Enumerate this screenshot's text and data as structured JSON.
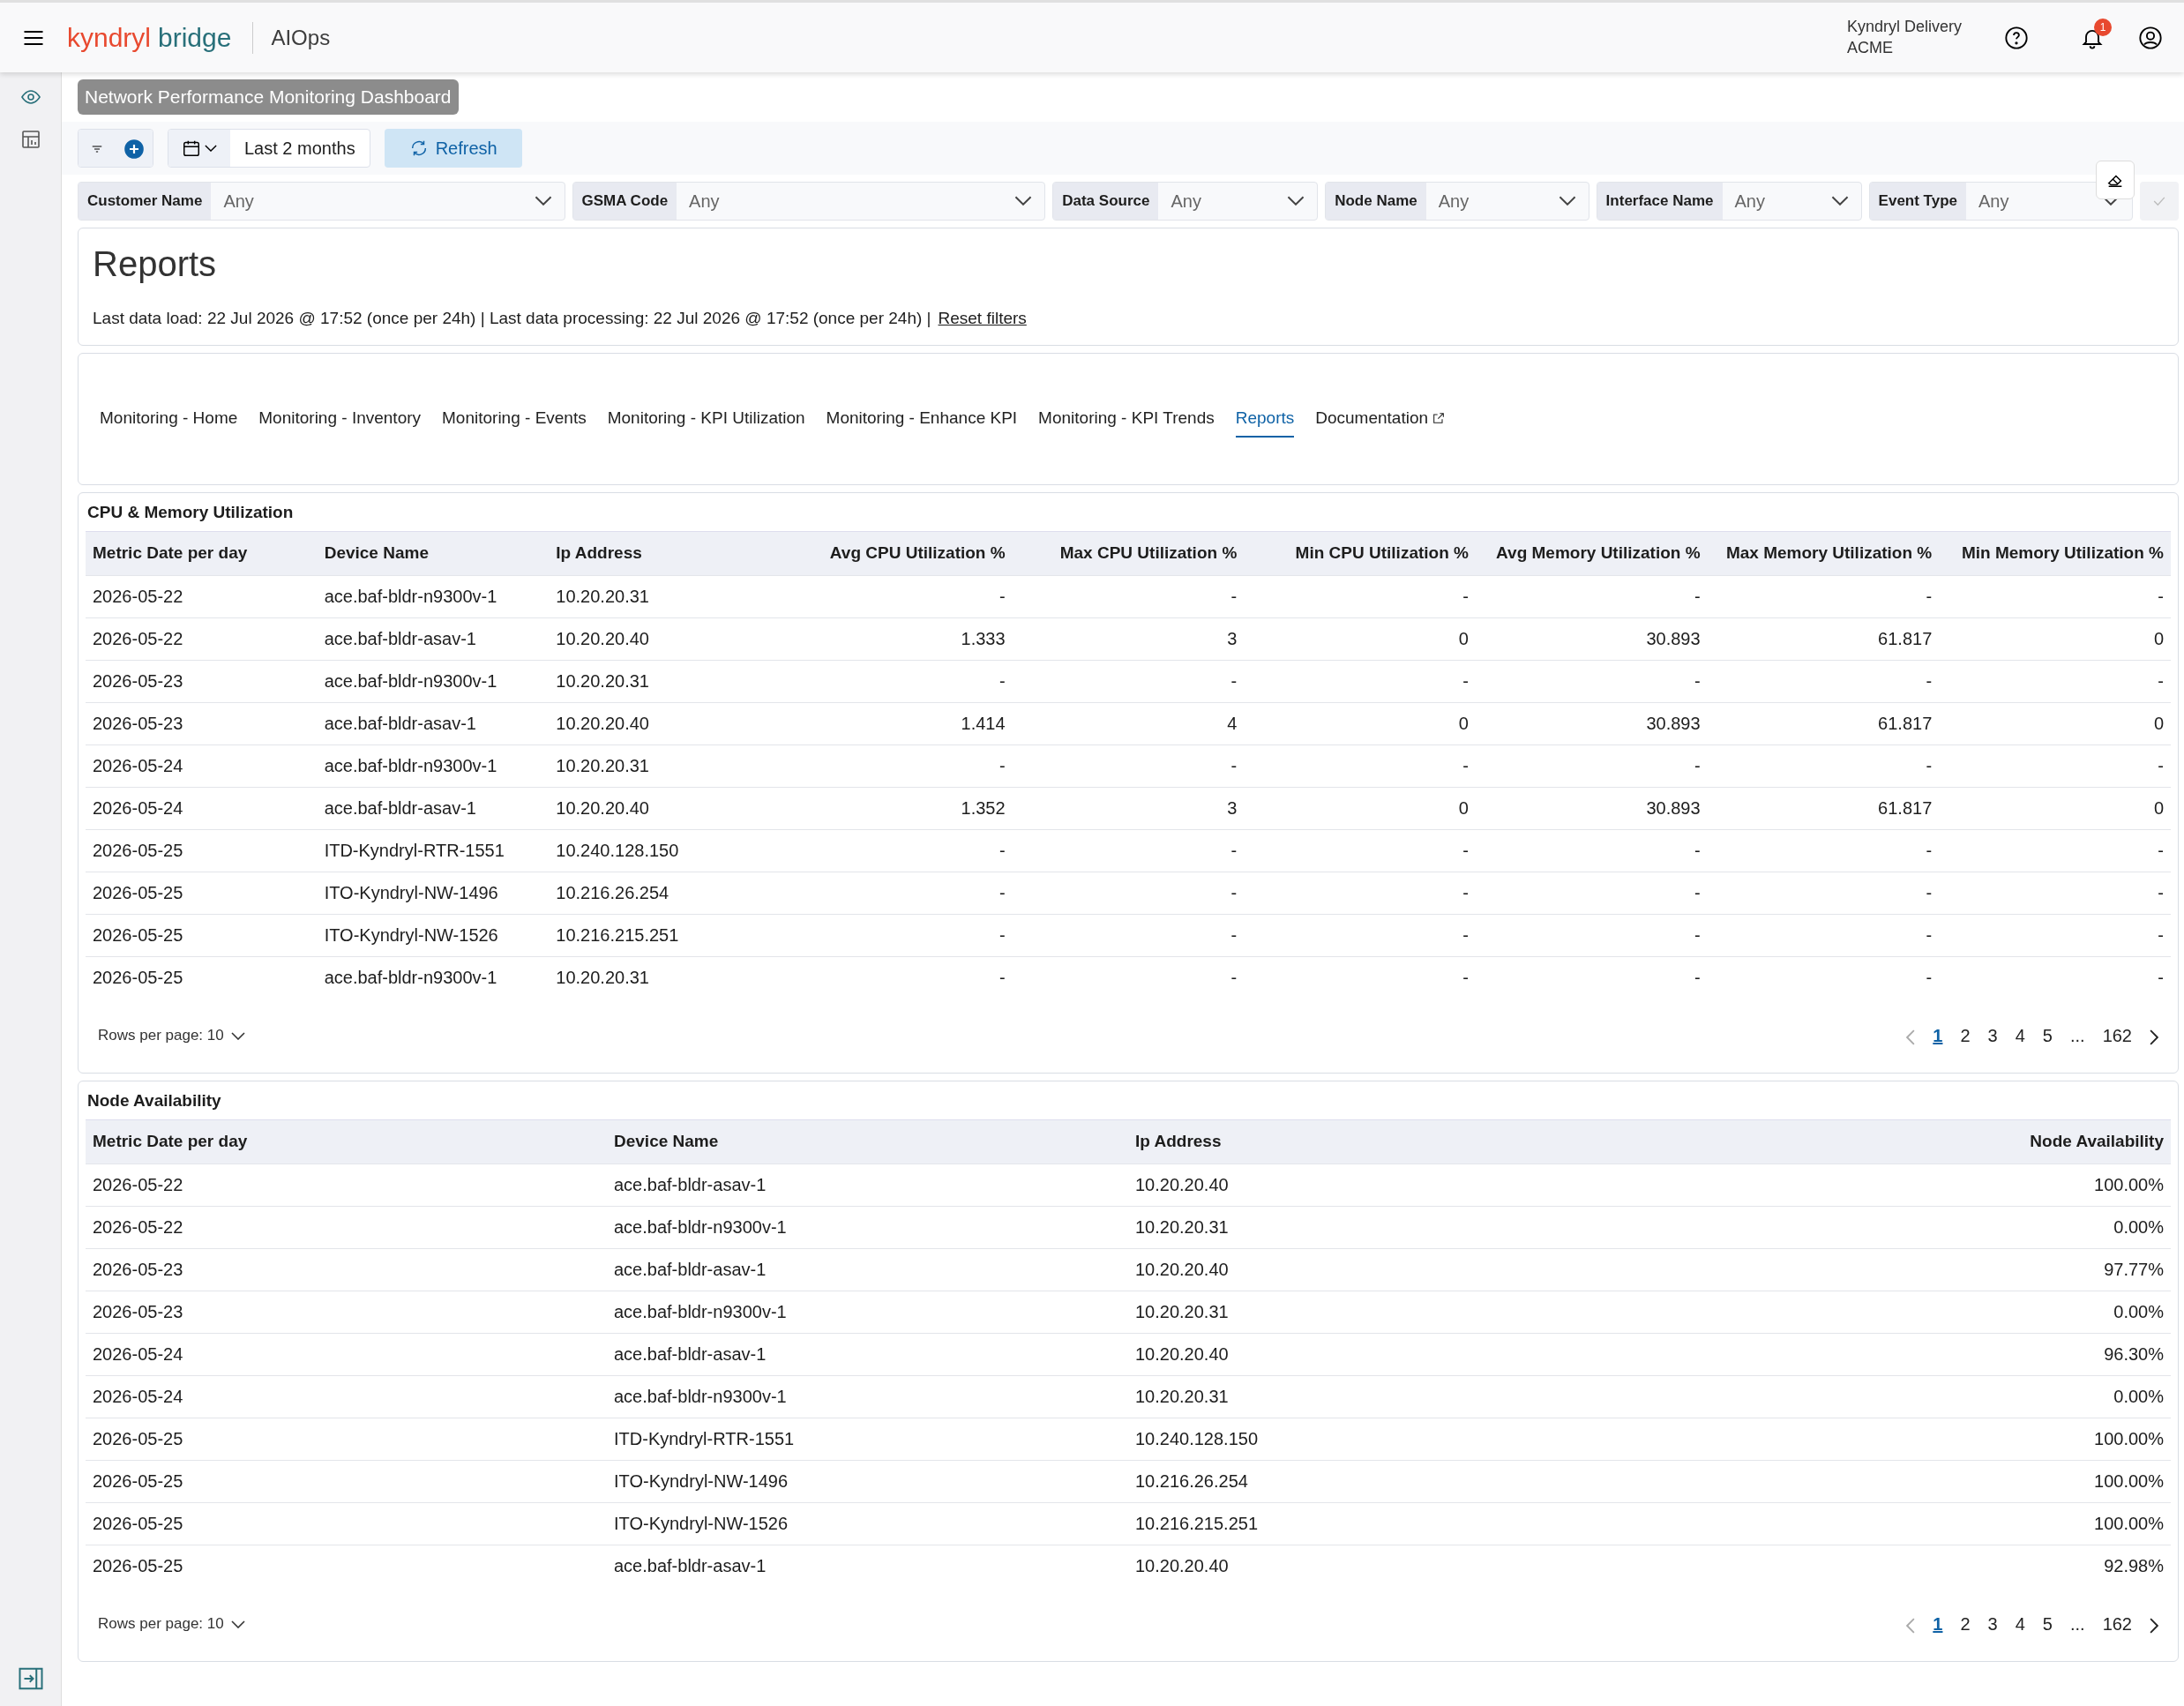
{
  "header": {
    "logo": {
      "first": "kyndryl",
      "second": "bridge"
    },
    "app_name": "AIOps",
    "account": {
      "line_1": "Kyndryl Delivery",
      "line_2": "ACME"
    },
    "notification_count": "1"
  },
  "dashboard_title": "Network Performance Monitoring Dashboard",
  "toolbar": {
    "date_range": "Last 2 months",
    "refresh": "Refresh"
  },
  "filters": [
    {
      "label": "Customer Name",
      "value": "Any"
    },
    {
      "label": "GSMA Code",
      "value": "Any"
    },
    {
      "label": "Data Source",
      "value": "Any"
    },
    {
      "label": "Node Name",
      "value": "Any"
    },
    {
      "label": "Interface Name",
      "value": "Any"
    },
    {
      "label": "Event Type",
      "value": "Any"
    }
  ],
  "reports": {
    "title": "Reports",
    "status": "Last data load: 22 Jul 2026 @ 17:52 (once per 24h) | Last data processing: 22 Jul 2026 @ 17:52 (once per 24h) |",
    "reset_link": "Reset filters"
  },
  "tabs": [
    {
      "label": "Monitoring - Home",
      "selected": false,
      "external": false
    },
    {
      "label": "Monitoring - Inventory",
      "selected": false,
      "external": false
    },
    {
      "label": "Monitoring - Events",
      "selected": false,
      "external": false
    },
    {
      "label": "Monitoring - KPI Utilization",
      "selected": false,
      "external": false
    },
    {
      "label": "Monitoring - Enhance KPI",
      "selected": false,
      "external": false
    },
    {
      "label": "Monitoring - KPI Trends",
      "selected": false,
      "external": false
    },
    {
      "label": "Reports",
      "selected": true,
      "external": false
    },
    {
      "label": "Documentation",
      "selected": false,
      "external": true
    }
  ],
  "tables": [
    {
      "title": "CPU & Memory Utilization",
      "columns": [
        {
          "label": "Metric Date per day",
          "kind": "text"
        },
        {
          "label": "Device Name",
          "kind": "text"
        },
        {
          "label": "Ip Address",
          "kind": "text"
        },
        {
          "label": "Avg CPU Utilization %",
          "kind": "number"
        },
        {
          "label": "Max CPU Utilization %",
          "kind": "number"
        },
        {
          "label": "Min CPU Utilization %",
          "kind": "number"
        },
        {
          "label": "Avg Memory Utilization %",
          "kind": "number"
        },
        {
          "label": "Max Memory Utilization %",
          "kind": "number"
        },
        {
          "label": "Min Memory Utilization %",
          "kind": "number"
        }
      ],
      "rows": [
        [
          "2026-05-22",
          "ace.baf-bldr-n9300v-1",
          "10.20.20.31",
          "-",
          "-",
          "-",
          "-",
          "-",
          "-"
        ],
        [
          "2026-05-22",
          "ace.baf-bldr-asav-1",
          "10.20.20.40",
          "1.333",
          "3",
          "0",
          "30.893",
          "61.817",
          "0"
        ],
        [
          "2026-05-23",
          "ace.baf-bldr-n9300v-1",
          "10.20.20.31",
          "-",
          "-",
          "-",
          "-",
          "-",
          "-"
        ],
        [
          "2026-05-23",
          "ace.baf-bldr-asav-1",
          "10.20.20.40",
          "1.414",
          "4",
          "0",
          "30.893",
          "61.817",
          "0"
        ],
        [
          "2026-05-24",
          "ace.baf-bldr-n9300v-1",
          "10.20.20.31",
          "-",
          "-",
          "-",
          "-",
          "-",
          "-"
        ],
        [
          "2026-05-24",
          "ace.baf-bldr-asav-1",
          "10.20.20.40",
          "1.352",
          "3",
          "0",
          "30.893",
          "61.817",
          "0"
        ],
        [
          "2026-05-25",
          "ITD-Kyndryl-RTR-1551",
          "10.240.128.150",
          "-",
          "-",
          "-",
          "-",
          "-",
          "-"
        ],
        [
          "2026-05-25",
          "ITO-Kyndryl-NW-1496",
          "10.216.26.254",
          "-",
          "-",
          "-",
          "-",
          "-",
          "-"
        ],
        [
          "2026-05-25",
          "ITO-Kyndryl-NW-1526",
          "10.216.215.251",
          "-",
          "-",
          "-",
          "-",
          "-",
          "-"
        ],
        [
          "2026-05-25",
          "ace.baf-bldr-n9300v-1",
          "10.20.20.31",
          "-",
          "-",
          "-",
          "-",
          "-",
          "-"
        ]
      ],
      "rows_per_page": "Rows per page: 10",
      "pagination": {
        "prev_disabled": true,
        "next_disabled": false,
        "pages": [
          {
            "label": "1",
            "selected": true
          },
          {
            "label": "2",
            "selected": false
          },
          {
            "label": "3",
            "selected": false
          },
          {
            "label": "4",
            "selected": false
          },
          {
            "label": "5",
            "selected": false
          },
          {
            "label": "...",
            "selected": false
          },
          {
            "label": "162",
            "selected": false
          }
        ]
      }
    },
    {
      "title": "Node Availability",
      "columns": [
        {
          "label": "Metric Date per day",
          "kind": "text"
        },
        {
          "label": "Device Name",
          "kind": "text"
        },
        {
          "label": "Ip Address",
          "kind": "text"
        },
        {
          "label": "Node Availability",
          "kind": "number"
        }
      ],
      "rows": [
        [
          "2026-05-22",
          "ace.baf-bldr-asav-1",
          "10.20.20.40",
          "100.00%"
        ],
        [
          "2026-05-22",
          "ace.baf-bldr-n9300v-1",
          "10.20.20.31",
          "0.00%"
        ],
        [
          "2026-05-23",
          "ace.baf-bldr-asav-1",
          "10.20.20.40",
          "97.77%"
        ],
        [
          "2026-05-23",
          "ace.baf-bldr-n9300v-1",
          "10.20.20.31",
          "0.00%"
        ],
        [
          "2026-05-24",
          "ace.baf-bldr-asav-1",
          "10.20.20.40",
          "96.30%"
        ],
        [
          "2026-05-24",
          "ace.baf-bldr-n9300v-1",
          "10.20.20.31",
          "0.00%"
        ],
        [
          "2026-05-25",
          "ITD-Kyndryl-RTR-1551",
          "10.240.128.150",
          "100.00%"
        ],
        [
          "2026-05-25",
          "ITO-Kyndryl-NW-1496",
          "10.216.26.254",
          "100.00%"
        ],
        [
          "2026-05-25",
          "ITO-Kyndryl-NW-1526",
          "10.216.215.251",
          "100.00%"
        ],
        [
          "2026-05-25",
          "ace.baf-bldr-asav-1",
          "10.20.20.40",
          "92.98%"
        ]
      ],
      "rows_per_page": "Rows per page: 10",
      "pagination": {
        "prev_disabled": true,
        "next_disabled": false,
        "pages": [
          {
            "label": "1",
            "selected": true
          },
          {
            "label": "2",
            "selected": false
          },
          {
            "label": "3",
            "selected": false
          },
          {
            "label": "4",
            "selected": false
          },
          {
            "label": "5",
            "selected": false
          },
          {
            "label": "...",
            "selected": false
          },
          {
            "label": "162",
            "selected": false
          }
        ]
      }
    }
  ]
}
